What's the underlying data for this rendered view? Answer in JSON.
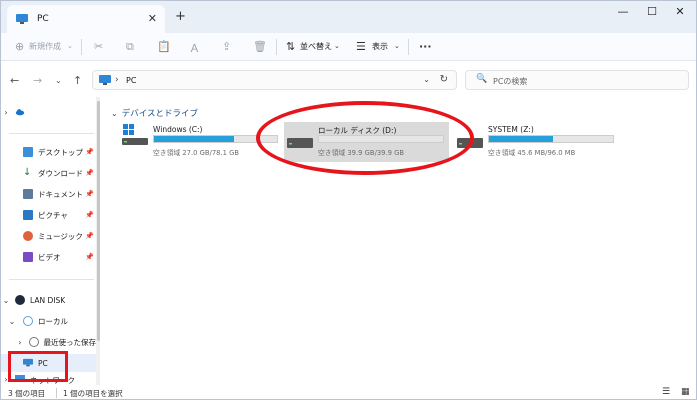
{
  "colors": {
    "accent": "#26a0da",
    "annotation_red": "#e6151c",
    "group_header": "#1d4f8a"
  },
  "tab": {
    "title": "PC",
    "icon": "pc-icon",
    "close": "✕",
    "add": "+"
  },
  "window_controls": {
    "minimize": "—",
    "maximize": "☐",
    "close": "✕"
  },
  "command_bar": {
    "new_label": "新規作成",
    "sort_label": "並べ替え",
    "view_label": "表示",
    "more": "···",
    "icons": [
      "cut-icon",
      "copy-icon",
      "paste-icon",
      "rename-icon",
      "share-icon",
      "delete-icon"
    ]
  },
  "address": {
    "path": "PC",
    "separator": "›"
  },
  "search": {
    "placeholder": "PCの検索"
  },
  "sidebar": {
    "items": [
      {
        "label": "デスクトップ",
        "icon": "desktop-icon",
        "pinned": true
      },
      {
        "label": "ダウンロード",
        "icon": "download-icon",
        "pinned": true
      },
      {
        "label": "ドキュメント",
        "icon": "document-icon",
        "pinned": true
      },
      {
        "label": "ピクチャ",
        "icon": "picture-icon",
        "pinned": true
      },
      {
        "label": "ミュージック",
        "icon": "music-icon",
        "pinned": true
      },
      {
        "label": "ビデオ",
        "icon": "video-icon",
        "pinned": true
      }
    ],
    "lan_disk": "LAN DISK",
    "local": "ローカル",
    "recent": "最近使った保存",
    "pc": "PC",
    "network": "ネットワーク",
    "onedrive_icon": "cloud-icon"
  },
  "content": {
    "group_title": "デバイスとドライブ",
    "drives": [
      {
        "name": "Windows (C:)",
        "free_text": "空き領域 27.0 GB/78.1 GB",
        "used_fraction": 0.65,
        "icon": "windows-drive-icon"
      },
      {
        "name": "ローカル ディスク (D:)",
        "free_text": "空き領域 39.9 GB/39.9 GB",
        "used_fraction": 0.0,
        "icon": "hdd-icon",
        "selected": true
      },
      {
        "name": "SYSTEM (Z:)",
        "free_text": "空き領域 45.6 MB/96.0 MB",
        "used_fraction": 0.52,
        "icon": "hdd-icon"
      }
    ]
  },
  "status": {
    "count": "3 個の項目",
    "selection": "1 個の項目を選択"
  }
}
